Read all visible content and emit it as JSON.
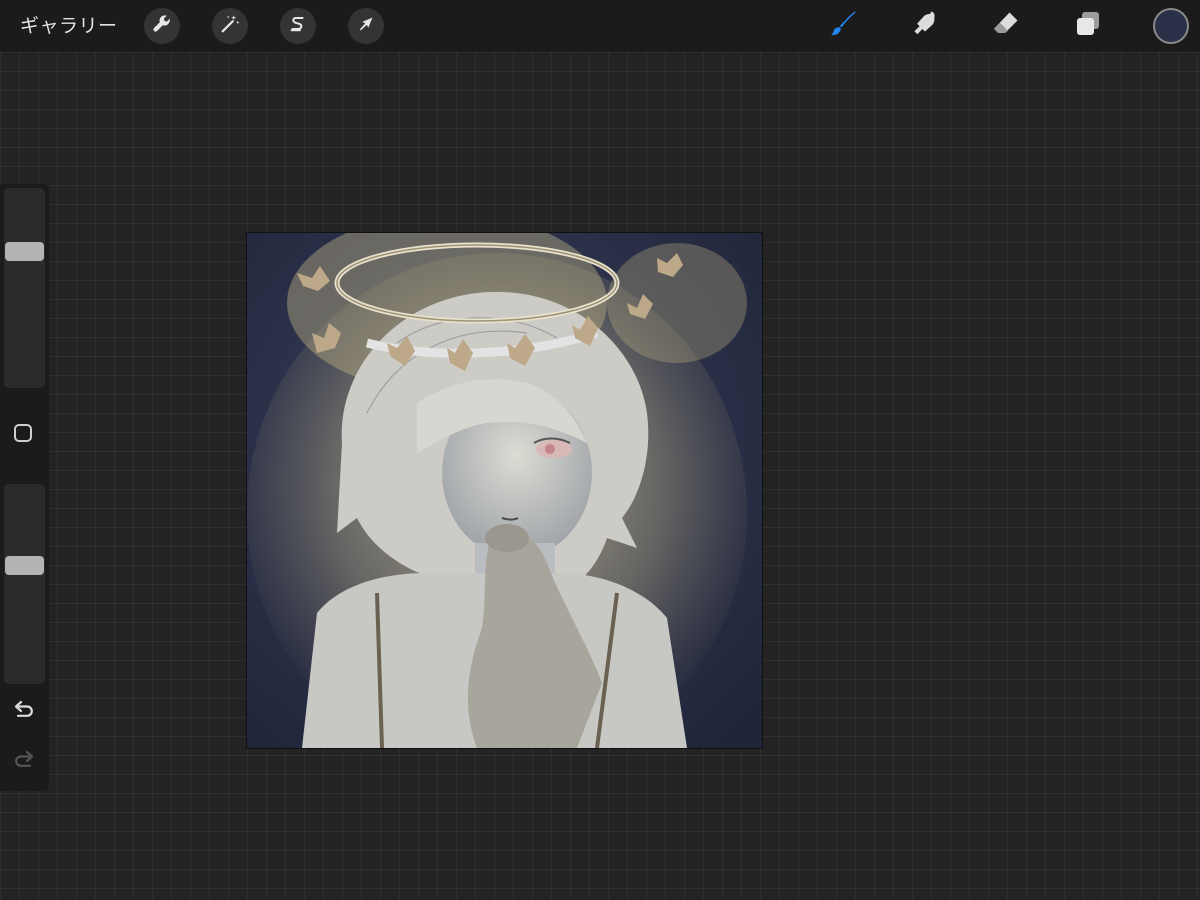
{
  "topbar": {
    "gallery_label": "ギャラリー",
    "left_tools": [
      {
        "name": "actions",
        "icon": "wrench-icon"
      },
      {
        "name": "adjustments",
        "icon": "magic-wand-icon"
      },
      {
        "name": "selection",
        "icon": "selection-s-icon"
      },
      {
        "name": "transform",
        "icon": "arrow-cursor-icon"
      }
    ],
    "right_tools": [
      {
        "name": "brush",
        "icon": "brush-icon",
        "active": true
      },
      {
        "name": "smudge",
        "icon": "smudge-finger-icon",
        "active": false
      },
      {
        "name": "eraser",
        "icon": "eraser-icon",
        "active": false
      },
      {
        "name": "layers",
        "icon": "layers-icon",
        "active": false
      }
    ],
    "current_color": "#2b3148"
  },
  "sidebar": {
    "brush_size_level": 0.7,
    "opacity_level": 0.6,
    "undo_icon": "undo-icon",
    "redo_icon": "redo-icon"
  },
  "colors": {
    "active_tool": "#1f86f2",
    "icon_default": "#dcdcdc",
    "canvas_background": "#2a3048"
  }
}
